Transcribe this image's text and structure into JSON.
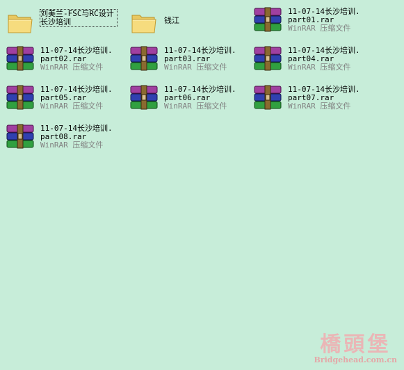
{
  "items": [
    {
      "kind": "folder",
      "name": "刘美兰-FSC与RC设计长沙培训",
      "selected": true
    },
    {
      "kind": "folder",
      "name": "钱江",
      "selected": false
    },
    {
      "kind": "rar",
      "line1": "11-07-14长沙培训.",
      "line2": "part01.rar",
      "type": "WinRAR 压缩文件"
    },
    {
      "kind": "rar",
      "line1": "11-07-14长沙培训.",
      "line2": "part02.rar",
      "type": "WinRAR 压缩文件"
    },
    {
      "kind": "rar",
      "line1": "11-07-14长沙培训.",
      "line2": "part03.rar",
      "type": "WinRAR 压缩文件"
    },
    {
      "kind": "rar",
      "line1": "11-07-14长沙培训.",
      "line2": "part04.rar",
      "type": "WinRAR 压缩文件"
    },
    {
      "kind": "rar",
      "line1": "11-07-14长沙培训.",
      "line2": "part05.rar",
      "type": "WinRAR 压缩文件"
    },
    {
      "kind": "rar",
      "line1": "11-07-14长沙培训.",
      "line2": "part06.rar",
      "type": "WinRAR 压缩文件"
    },
    {
      "kind": "rar",
      "line1": "11-07-14长沙培训.",
      "line2": "part07.rar",
      "type": "WinRAR 压缩文件"
    },
    {
      "kind": "rar",
      "line1": "11-07-14长沙培训.",
      "line2": "part08.rar",
      "type": "WinRAR 压缩文件"
    }
  ],
  "watermark": {
    "cn": "橋頭堡",
    "en": "Bridgehead.com.cn"
  }
}
